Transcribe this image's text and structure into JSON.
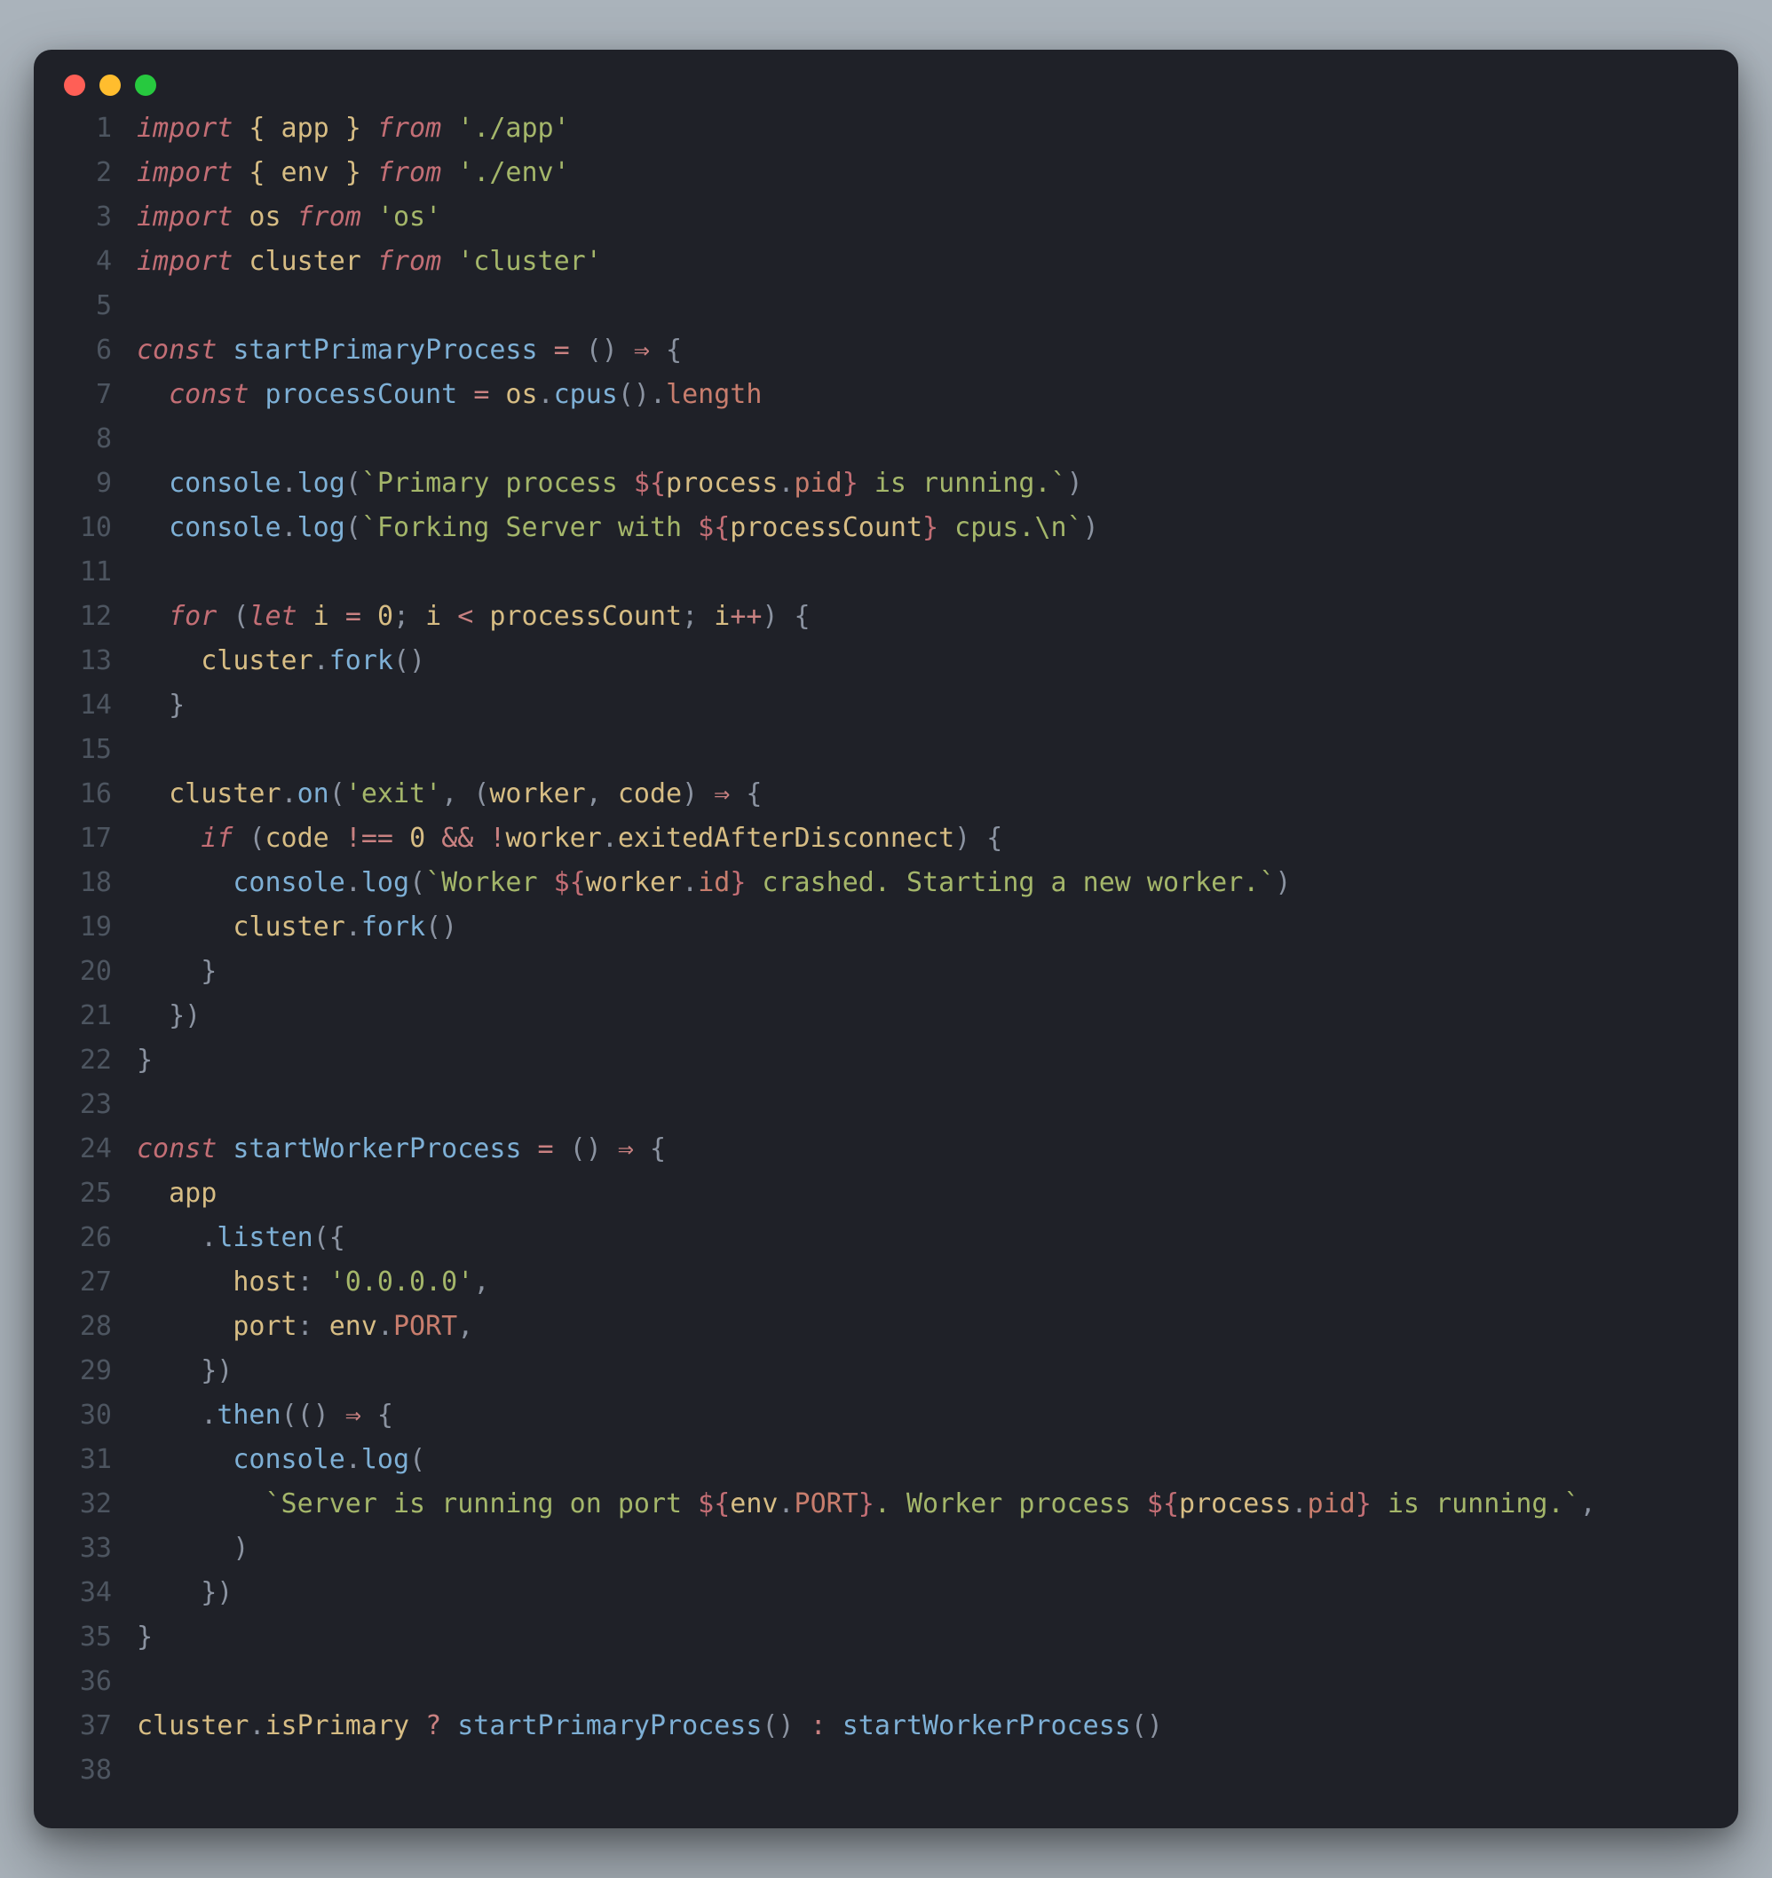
{
  "window": {
    "dots": [
      "red",
      "yellow",
      "green"
    ]
  },
  "code": {
    "lines": [
      [
        {
          "c": "c-kw",
          "t": "import"
        },
        {
          "c": "c-def",
          "t": " { app } "
        },
        {
          "c": "c-kw",
          "t": "from"
        },
        {
          "c": "c-def",
          "t": " "
        },
        {
          "c": "c-str",
          "t": "'./app'"
        }
      ],
      [
        {
          "c": "c-kw",
          "t": "import"
        },
        {
          "c": "c-def",
          "t": " { env } "
        },
        {
          "c": "c-kw",
          "t": "from"
        },
        {
          "c": "c-def",
          "t": " "
        },
        {
          "c": "c-str",
          "t": "'./env'"
        }
      ],
      [
        {
          "c": "c-kw",
          "t": "import"
        },
        {
          "c": "c-def",
          "t": " os "
        },
        {
          "c": "c-kw",
          "t": "from"
        },
        {
          "c": "c-def",
          "t": " "
        },
        {
          "c": "c-str",
          "t": "'os'"
        }
      ],
      [
        {
          "c": "c-kw",
          "t": "import"
        },
        {
          "c": "c-def",
          "t": " cluster "
        },
        {
          "c": "c-kw",
          "t": "from"
        },
        {
          "c": "c-def",
          "t": " "
        },
        {
          "c": "c-str",
          "t": "'cluster'"
        }
      ],
      [],
      [
        {
          "c": "c-kw",
          "t": "const"
        },
        {
          "c": "c-def",
          "t": " "
        },
        {
          "c": "c-fn",
          "t": "startPrimaryProcess"
        },
        {
          "c": "c-def",
          "t": " "
        },
        {
          "c": "c-op",
          "t": "="
        },
        {
          "c": "c-def",
          "t": " "
        },
        {
          "c": "c-punc",
          "t": "()"
        },
        {
          "c": "c-def",
          "t": " "
        },
        {
          "c": "c-op",
          "t": "⇒"
        },
        {
          "c": "c-def",
          "t": " "
        },
        {
          "c": "c-punc",
          "t": "{"
        }
      ],
      [
        {
          "c": "c-def",
          "t": "  "
        },
        {
          "c": "c-kw",
          "t": "const"
        },
        {
          "c": "c-def",
          "t": " "
        },
        {
          "c": "c-fn",
          "t": "processCount"
        },
        {
          "c": "c-def",
          "t": " "
        },
        {
          "c": "c-op",
          "t": "="
        },
        {
          "c": "c-def",
          "t": " os"
        },
        {
          "c": "c-punc",
          "t": "."
        },
        {
          "c": "c-fn",
          "t": "cpus"
        },
        {
          "c": "c-punc",
          "t": "()."
        },
        {
          "c": "c-prop",
          "t": "length"
        }
      ],
      [],
      [
        {
          "c": "c-def",
          "t": "  "
        },
        {
          "c": "c-fn",
          "t": "console"
        },
        {
          "c": "c-punc",
          "t": "."
        },
        {
          "c": "c-fn",
          "t": "log"
        },
        {
          "c": "c-punc",
          "t": "("
        },
        {
          "c": "c-str",
          "t": "`Primary process "
        },
        {
          "c": "c-tmpl",
          "t": "${"
        },
        {
          "c": "c-def",
          "t": "process"
        },
        {
          "c": "c-punc",
          "t": "."
        },
        {
          "c": "c-prop",
          "t": "pid"
        },
        {
          "c": "c-tmpl",
          "t": "}"
        },
        {
          "c": "c-str",
          "t": " is running.`"
        },
        {
          "c": "c-punc",
          "t": ")"
        }
      ],
      [
        {
          "c": "c-def",
          "t": "  "
        },
        {
          "c": "c-fn",
          "t": "console"
        },
        {
          "c": "c-punc",
          "t": "."
        },
        {
          "c": "c-fn",
          "t": "log"
        },
        {
          "c": "c-punc",
          "t": "("
        },
        {
          "c": "c-str",
          "t": "`Forking Server with "
        },
        {
          "c": "c-tmpl",
          "t": "${"
        },
        {
          "c": "c-def",
          "t": "processCount"
        },
        {
          "c": "c-tmpl",
          "t": "}"
        },
        {
          "c": "c-str",
          "t": " cpus.\\n`"
        },
        {
          "c": "c-punc",
          "t": ")"
        }
      ],
      [],
      [
        {
          "c": "c-def",
          "t": "  "
        },
        {
          "c": "c-kw",
          "t": "for"
        },
        {
          "c": "c-def",
          "t": " "
        },
        {
          "c": "c-punc",
          "t": "("
        },
        {
          "c": "c-kw",
          "t": "let"
        },
        {
          "c": "c-def",
          "t": " i "
        },
        {
          "c": "c-op",
          "t": "="
        },
        {
          "c": "c-def",
          "t": " "
        },
        {
          "c": "c-num",
          "t": "0"
        },
        {
          "c": "c-punc",
          "t": "; "
        },
        {
          "c": "c-def",
          "t": "i "
        },
        {
          "c": "c-op",
          "t": "<"
        },
        {
          "c": "c-def",
          "t": " processCount"
        },
        {
          "c": "c-punc",
          "t": "; "
        },
        {
          "c": "c-def",
          "t": "i"
        },
        {
          "c": "c-op",
          "t": "++"
        },
        {
          "c": "c-punc",
          "t": ") {"
        }
      ],
      [
        {
          "c": "c-def",
          "t": "    cluster"
        },
        {
          "c": "c-punc",
          "t": "."
        },
        {
          "c": "c-fn",
          "t": "fork"
        },
        {
          "c": "c-punc",
          "t": "()"
        }
      ],
      [
        {
          "c": "c-def",
          "t": "  "
        },
        {
          "c": "c-punc",
          "t": "}"
        }
      ],
      [],
      [
        {
          "c": "c-def",
          "t": "  cluster"
        },
        {
          "c": "c-punc",
          "t": "."
        },
        {
          "c": "c-fn",
          "t": "on"
        },
        {
          "c": "c-punc",
          "t": "("
        },
        {
          "c": "c-str",
          "t": "'exit'"
        },
        {
          "c": "c-punc",
          "t": ", ("
        },
        {
          "c": "c-def",
          "t": "worker"
        },
        {
          "c": "c-punc",
          "t": ", "
        },
        {
          "c": "c-def",
          "t": "code"
        },
        {
          "c": "c-punc",
          "t": ") "
        },
        {
          "c": "c-op",
          "t": "⇒"
        },
        {
          "c": "c-punc",
          "t": " {"
        }
      ],
      [
        {
          "c": "c-def",
          "t": "    "
        },
        {
          "c": "c-kw",
          "t": "if"
        },
        {
          "c": "c-def",
          "t": " "
        },
        {
          "c": "c-punc",
          "t": "("
        },
        {
          "c": "c-def",
          "t": "code "
        },
        {
          "c": "c-op",
          "t": "!=="
        },
        {
          "c": "c-def",
          "t": " "
        },
        {
          "c": "c-num",
          "t": "0"
        },
        {
          "c": "c-def",
          "t": " "
        },
        {
          "c": "c-op",
          "t": "&&"
        },
        {
          "c": "c-def",
          "t": " "
        },
        {
          "c": "c-op",
          "t": "!"
        },
        {
          "c": "c-def",
          "t": "worker"
        },
        {
          "c": "c-punc",
          "t": "."
        },
        {
          "c": "c-def",
          "t": "exitedAfterDisconnect"
        },
        {
          "c": "c-punc",
          "t": ") {"
        }
      ],
      [
        {
          "c": "c-def",
          "t": "      "
        },
        {
          "c": "c-fn",
          "t": "console"
        },
        {
          "c": "c-punc",
          "t": "."
        },
        {
          "c": "c-fn",
          "t": "log"
        },
        {
          "c": "c-punc",
          "t": "("
        },
        {
          "c": "c-str",
          "t": "`Worker "
        },
        {
          "c": "c-tmpl",
          "t": "${"
        },
        {
          "c": "c-def",
          "t": "worker"
        },
        {
          "c": "c-punc",
          "t": "."
        },
        {
          "c": "c-prop",
          "t": "id"
        },
        {
          "c": "c-tmpl",
          "t": "}"
        },
        {
          "c": "c-str",
          "t": " crashed. Starting a new worker.`"
        },
        {
          "c": "c-punc",
          "t": ")"
        }
      ],
      [
        {
          "c": "c-def",
          "t": "      cluster"
        },
        {
          "c": "c-punc",
          "t": "."
        },
        {
          "c": "c-fn",
          "t": "fork"
        },
        {
          "c": "c-punc",
          "t": "()"
        }
      ],
      [
        {
          "c": "c-def",
          "t": "    "
        },
        {
          "c": "c-punc",
          "t": "}"
        }
      ],
      [
        {
          "c": "c-def",
          "t": "  "
        },
        {
          "c": "c-punc",
          "t": "})"
        }
      ],
      [
        {
          "c": "c-punc",
          "t": "}"
        }
      ],
      [],
      [
        {
          "c": "c-kw",
          "t": "const"
        },
        {
          "c": "c-def",
          "t": " "
        },
        {
          "c": "c-fn",
          "t": "startWorkerProcess"
        },
        {
          "c": "c-def",
          "t": " "
        },
        {
          "c": "c-op",
          "t": "="
        },
        {
          "c": "c-def",
          "t": " "
        },
        {
          "c": "c-punc",
          "t": "()"
        },
        {
          "c": "c-def",
          "t": " "
        },
        {
          "c": "c-op",
          "t": "⇒"
        },
        {
          "c": "c-def",
          "t": " "
        },
        {
          "c": "c-punc",
          "t": "{"
        }
      ],
      [
        {
          "c": "c-def",
          "t": "  app"
        }
      ],
      [
        {
          "c": "c-def",
          "t": "    "
        },
        {
          "c": "c-punc",
          "t": "."
        },
        {
          "c": "c-fn",
          "t": "listen"
        },
        {
          "c": "c-punc",
          "t": "({"
        }
      ],
      [
        {
          "c": "c-def",
          "t": "      host"
        },
        {
          "c": "c-punc",
          "t": ": "
        },
        {
          "c": "c-str",
          "t": "'0.0.0.0'"
        },
        {
          "c": "c-punc",
          "t": ","
        }
      ],
      [
        {
          "c": "c-def",
          "t": "      port"
        },
        {
          "c": "c-punc",
          "t": ": "
        },
        {
          "c": "c-def",
          "t": "env"
        },
        {
          "c": "c-punc",
          "t": "."
        },
        {
          "c": "c-prop",
          "t": "PORT"
        },
        {
          "c": "c-punc",
          "t": ","
        }
      ],
      [
        {
          "c": "c-def",
          "t": "    "
        },
        {
          "c": "c-punc",
          "t": "})"
        }
      ],
      [
        {
          "c": "c-def",
          "t": "    "
        },
        {
          "c": "c-punc",
          "t": "."
        },
        {
          "c": "c-fn",
          "t": "then"
        },
        {
          "c": "c-punc",
          "t": "(() "
        },
        {
          "c": "c-op",
          "t": "⇒"
        },
        {
          "c": "c-punc",
          "t": " {"
        }
      ],
      [
        {
          "c": "c-def",
          "t": "      "
        },
        {
          "c": "c-fn",
          "t": "console"
        },
        {
          "c": "c-punc",
          "t": "."
        },
        {
          "c": "c-fn",
          "t": "log"
        },
        {
          "c": "c-punc",
          "t": "("
        }
      ],
      [
        {
          "c": "c-def",
          "t": "        "
        },
        {
          "c": "c-str",
          "t": "`Server is running on port "
        },
        {
          "c": "c-tmpl",
          "t": "${"
        },
        {
          "c": "c-def",
          "t": "env"
        },
        {
          "c": "c-punc",
          "t": "."
        },
        {
          "c": "c-prop",
          "t": "PORT"
        },
        {
          "c": "c-tmpl",
          "t": "}"
        },
        {
          "c": "c-str",
          "t": ". Worker process "
        },
        {
          "c": "c-tmpl",
          "t": "${"
        },
        {
          "c": "c-def",
          "t": "process"
        },
        {
          "c": "c-punc",
          "t": "."
        },
        {
          "c": "c-prop",
          "t": "pid"
        },
        {
          "c": "c-tmpl",
          "t": "}"
        },
        {
          "c": "c-str",
          "t": " is running.`"
        },
        {
          "c": "c-punc",
          "t": ","
        }
      ],
      [
        {
          "c": "c-def",
          "t": "      "
        },
        {
          "c": "c-punc",
          "t": ")"
        }
      ],
      [
        {
          "c": "c-def",
          "t": "    "
        },
        {
          "c": "c-punc",
          "t": "})"
        }
      ],
      [
        {
          "c": "c-punc",
          "t": "}"
        }
      ],
      [],
      [
        {
          "c": "c-def",
          "t": "cluster"
        },
        {
          "c": "c-punc",
          "t": "."
        },
        {
          "c": "c-def",
          "t": "isPrimary "
        },
        {
          "c": "c-op",
          "t": "?"
        },
        {
          "c": "c-def",
          "t": " "
        },
        {
          "c": "c-fn",
          "t": "startPrimaryProcess"
        },
        {
          "c": "c-punc",
          "t": "()"
        },
        {
          "c": "c-def",
          "t": " "
        },
        {
          "c": "c-op",
          "t": ":"
        },
        {
          "c": "c-def",
          "t": " "
        },
        {
          "c": "c-fn",
          "t": "startWorkerProcess"
        },
        {
          "c": "c-punc",
          "t": "()"
        }
      ],
      []
    ]
  }
}
